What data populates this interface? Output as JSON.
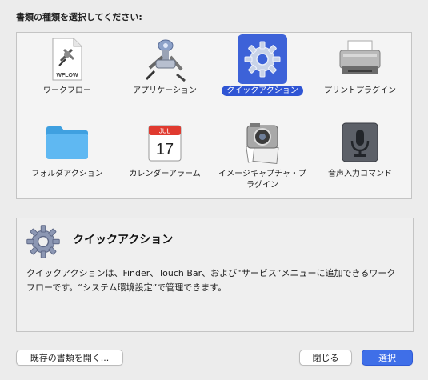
{
  "prompt": "書類の種類を選択してください:",
  "items": [
    {
      "label": "ワークフロー",
      "icon": "workflow-document-icon"
    },
    {
      "label": "アプリケーション",
      "icon": "automator-robot-icon"
    },
    {
      "label": "クイックアクション",
      "icon": "gear-icon",
      "selected": true
    },
    {
      "label": "プリントプラグイン",
      "icon": "printer-icon"
    },
    {
      "label": "フォルダアクション",
      "icon": "folder-icon"
    },
    {
      "label": "カレンダーアラーム",
      "icon": "calendar-icon"
    },
    {
      "label": "イメージキャプチャ・プラグイン",
      "icon": "camera-icon"
    },
    {
      "label": "音声入力コマンド",
      "icon": "microphone-icon"
    }
  ],
  "workflow_icon_text": "WFLOW",
  "calendar": {
    "month": "JUL",
    "day": "17"
  },
  "description": {
    "title": "クイックアクション",
    "body": "クイックアクションは、Finder、Touch Bar、および“サービス”メニューに追加できるワークフローです。“システム環境設定”で管理できます。"
  },
  "buttons": {
    "open_existing": "既存の書類を開く...",
    "close": "閉じる",
    "choose": "選択"
  },
  "colors": {
    "accent": "#3f6fe8",
    "selection": "#2f55d4"
  }
}
